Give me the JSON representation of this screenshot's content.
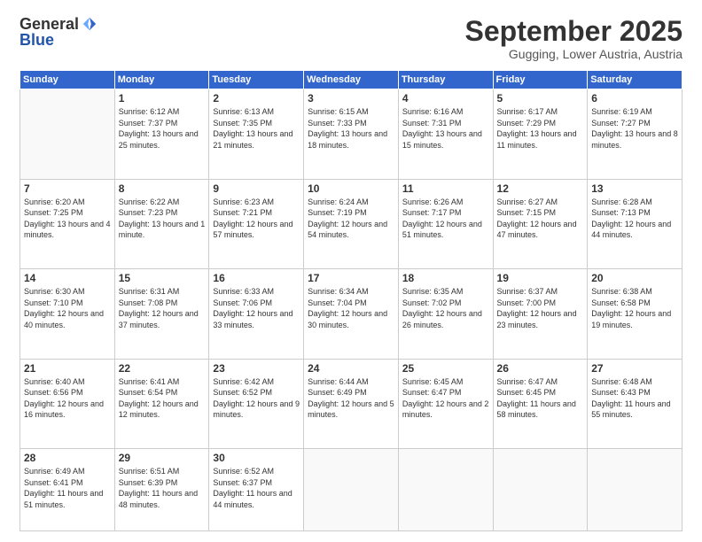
{
  "logo": {
    "general": "General",
    "blue": "Blue"
  },
  "title": "September 2025",
  "subtitle": "Gugging, Lower Austria, Austria",
  "weekdays": [
    "Sunday",
    "Monday",
    "Tuesday",
    "Wednesday",
    "Thursday",
    "Friday",
    "Saturday"
  ],
  "weeks": [
    [
      {
        "day": null
      },
      {
        "day": 1,
        "sunrise": "Sunrise: 6:12 AM",
        "sunset": "Sunset: 7:37 PM",
        "daylight": "Daylight: 13 hours and 25 minutes."
      },
      {
        "day": 2,
        "sunrise": "Sunrise: 6:13 AM",
        "sunset": "Sunset: 7:35 PM",
        "daylight": "Daylight: 13 hours and 21 minutes."
      },
      {
        "day": 3,
        "sunrise": "Sunrise: 6:15 AM",
        "sunset": "Sunset: 7:33 PM",
        "daylight": "Daylight: 13 hours and 18 minutes."
      },
      {
        "day": 4,
        "sunrise": "Sunrise: 6:16 AM",
        "sunset": "Sunset: 7:31 PM",
        "daylight": "Daylight: 13 hours and 15 minutes."
      },
      {
        "day": 5,
        "sunrise": "Sunrise: 6:17 AM",
        "sunset": "Sunset: 7:29 PM",
        "daylight": "Daylight: 13 hours and 11 minutes."
      },
      {
        "day": 6,
        "sunrise": "Sunrise: 6:19 AM",
        "sunset": "Sunset: 7:27 PM",
        "daylight": "Daylight: 13 hours and 8 minutes."
      }
    ],
    [
      {
        "day": 7,
        "sunrise": "Sunrise: 6:20 AM",
        "sunset": "Sunset: 7:25 PM",
        "daylight": "Daylight: 13 hours and 4 minutes."
      },
      {
        "day": 8,
        "sunrise": "Sunrise: 6:22 AM",
        "sunset": "Sunset: 7:23 PM",
        "daylight": "Daylight: 13 hours and 1 minute."
      },
      {
        "day": 9,
        "sunrise": "Sunrise: 6:23 AM",
        "sunset": "Sunset: 7:21 PM",
        "daylight": "Daylight: 12 hours and 57 minutes."
      },
      {
        "day": 10,
        "sunrise": "Sunrise: 6:24 AM",
        "sunset": "Sunset: 7:19 PM",
        "daylight": "Daylight: 12 hours and 54 minutes."
      },
      {
        "day": 11,
        "sunrise": "Sunrise: 6:26 AM",
        "sunset": "Sunset: 7:17 PM",
        "daylight": "Daylight: 12 hours and 51 minutes."
      },
      {
        "day": 12,
        "sunrise": "Sunrise: 6:27 AM",
        "sunset": "Sunset: 7:15 PM",
        "daylight": "Daylight: 12 hours and 47 minutes."
      },
      {
        "day": 13,
        "sunrise": "Sunrise: 6:28 AM",
        "sunset": "Sunset: 7:13 PM",
        "daylight": "Daylight: 12 hours and 44 minutes."
      }
    ],
    [
      {
        "day": 14,
        "sunrise": "Sunrise: 6:30 AM",
        "sunset": "Sunset: 7:10 PM",
        "daylight": "Daylight: 12 hours and 40 minutes."
      },
      {
        "day": 15,
        "sunrise": "Sunrise: 6:31 AM",
        "sunset": "Sunset: 7:08 PM",
        "daylight": "Daylight: 12 hours and 37 minutes."
      },
      {
        "day": 16,
        "sunrise": "Sunrise: 6:33 AM",
        "sunset": "Sunset: 7:06 PM",
        "daylight": "Daylight: 12 hours and 33 minutes."
      },
      {
        "day": 17,
        "sunrise": "Sunrise: 6:34 AM",
        "sunset": "Sunset: 7:04 PM",
        "daylight": "Daylight: 12 hours and 30 minutes."
      },
      {
        "day": 18,
        "sunrise": "Sunrise: 6:35 AM",
        "sunset": "Sunset: 7:02 PM",
        "daylight": "Daylight: 12 hours and 26 minutes."
      },
      {
        "day": 19,
        "sunrise": "Sunrise: 6:37 AM",
        "sunset": "Sunset: 7:00 PM",
        "daylight": "Daylight: 12 hours and 23 minutes."
      },
      {
        "day": 20,
        "sunrise": "Sunrise: 6:38 AM",
        "sunset": "Sunset: 6:58 PM",
        "daylight": "Daylight: 12 hours and 19 minutes."
      }
    ],
    [
      {
        "day": 21,
        "sunrise": "Sunrise: 6:40 AM",
        "sunset": "Sunset: 6:56 PM",
        "daylight": "Daylight: 12 hours and 16 minutes."
      },
      {
        "day": 22,
        "sunrise": "Sunrise: 6:41 AM",
        "sunset": "Sunset: 6:54 PM",
        "daylight": "Daylight: 12 hours and 12 minutes."
      },
      {
        "day": 23,
        "sunrise": "Sunrise: 6:42 AM",
        "sunset": "Sunset: 6:52 PM",
        "daylight": "Daylight: 12 hours and 9 minutes."
      },
      {
        "day": 24,
        "sunrise": "Sunrise: 6:44 AM",
        "sunset": "Sunset: 6:49 PM",
        "daylight": "Daylight: 12 hours and 5 minutes."
      },
      {
        "day": 25,
        "sunrise": "Sunrise: 6:45 AM",
        "sunset": "Sunset: 6:47 PM",
        "daylight": "Daylight: 12 hours and 2 minutes."
      },
      {
        "day": 26,
        "sunrise": "Sunrise: 6:47 AM",
        "sunset": "Sunset: 6:45 PM",
        "daylight": "Daylight: 11 hours and 58 minutes."
      },
      {
        "day": 27,
        "sunrise": "Sunrise: 6:48 AM",
        "sunset": "Sunset: 6:43 PM",
        "daylight": "Daylight: 11 hours and 55 minutes."
      }
    ],
    [
      {
        "day": 28,
        "sunrise": "Sunrise: 6:49 AM",
        "sunset": "Sunset: 6:41 PM",
        "daylight": "Daylight: 11 hours and 51 minutes."
      },
      {
        "day": 29,
        "sunrise": "Sunrise: 6:51 AM",
        "sunset": "Sunset: 6:39 PM",
        "daylight": "Daylight: 11 hours and 48 minutes."
      },
      {
        "day": 30,
        "sunrise": "Sunrise: 6:52 AM",
        "sunset": "Sunset: 6:37 PM",
        "daylight": "Daylight: 11 hours and 44 minutes."
      },
      {
        "day": null
      },
      {
        "day": null
      },
      {
        "day": null
      },
      {
        "day": null
      }
    ]
  ]
}
